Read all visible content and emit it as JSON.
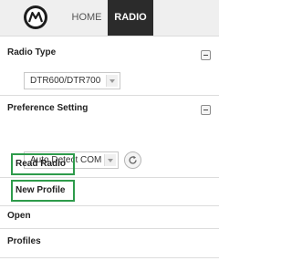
{
  "header": {
    "logo_icon": "motorola-logo",
    "tabs": [
      {
        "label": "HOME",
        "active": false
      },
      {
        "label": "RADIO",
        "active": true
      }
    ]
  },
  "radio_type": {
    "title": "Radio Type",
    "selected": "DTR600/DTR700"
  },
  "preference_setting": {
    "title": "Preference Setting",
    "selected": "Auto Detect COM",
    "refresh_icon": "refresh-icon"
  },
  "menu": {
    "read_radio": "Read Radio",
    "new_profile": "New Profile",
    "open": "Open",
    "profiles": "Profiles"
  },
  "colors": {
    "highlight": "#2e9b4b",
    "active_tab": "#2b2b2b"
  }
}
